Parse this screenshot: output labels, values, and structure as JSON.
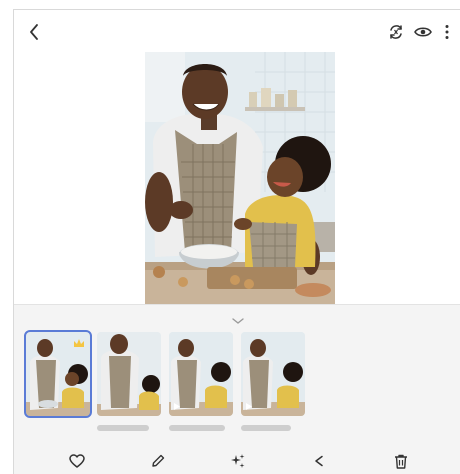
{
  "top_bar": {
    "back_icon": "chevron-left-icon",
    "actions": [
      "remaster-icon",
      "eye-icon",
      "more-vertical-icon"
    ]
  },
  "photo": {
    "description_icon": "photo-father-child-baking"
  },
  "thumbnails": [
    {
      "label": "",
      "selected": true,
      "badge": "crown-icon"
    },
    {
      "label": "",
      "selected": false
    },
    {
      "label": "",
      "selected": false,
      "badge": "play-icon"
    },
    {
      "label": "",
      "selected": false,
      "badge": "play-icon"
    }
  ],
  "bottom_bar": {
    "actions": [
      "heart-icon",
      "pencil-icon",
      "sparkle-icon",
      "share-icon",
      "trash-icon"
    ]
  },
  "colors": {
    "selection_outline": "#5a7bd6",
    "crown": "#f4c542",
    "icon": "#333333"
  }
}
